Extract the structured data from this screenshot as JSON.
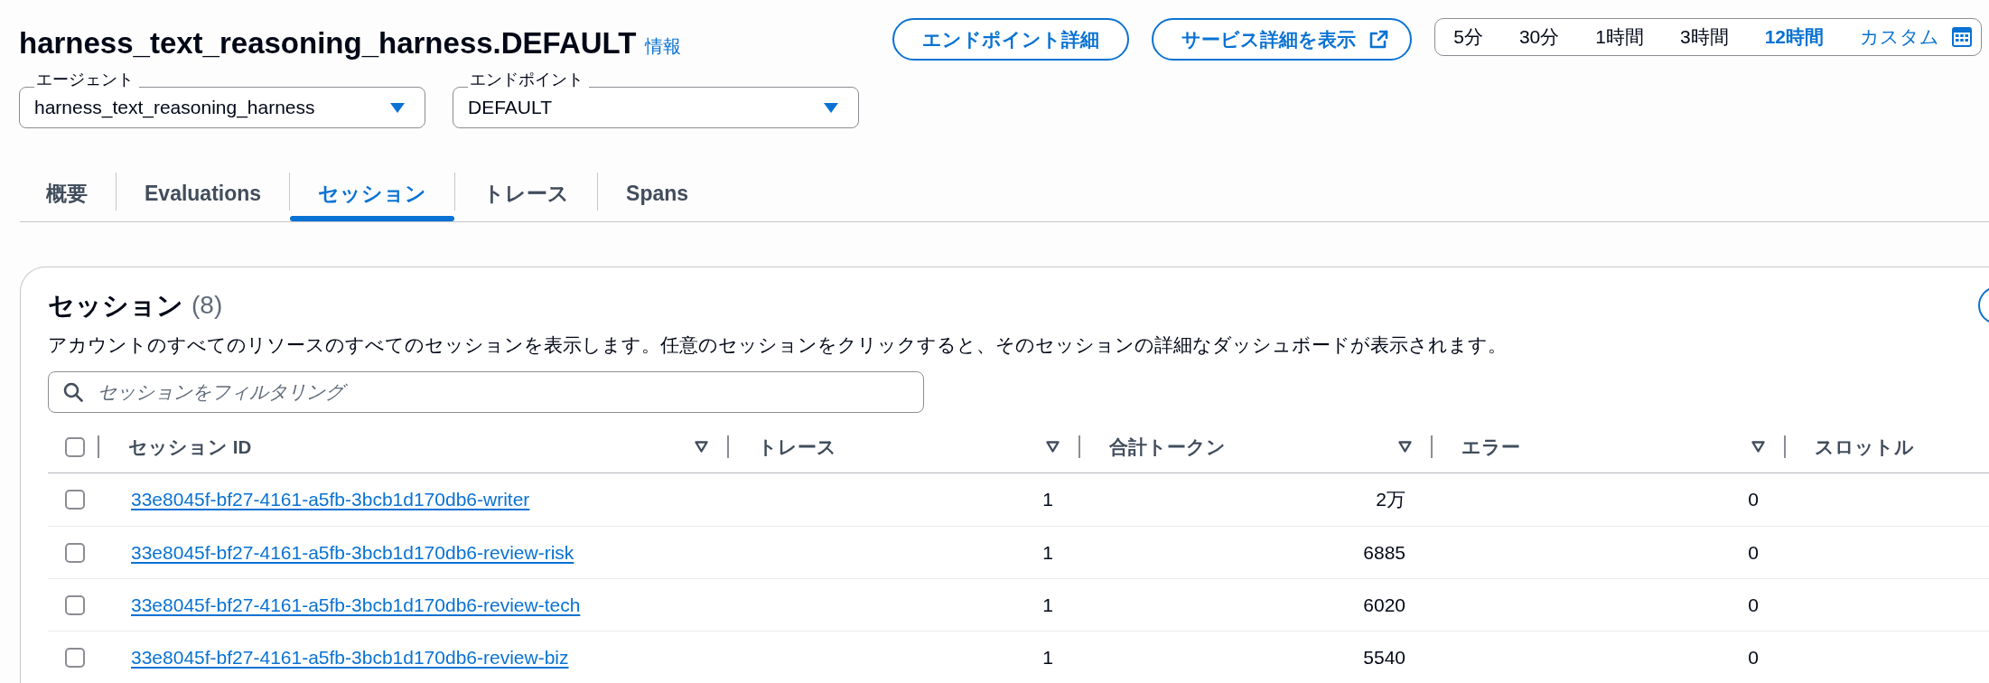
{
  "header": {
    "title": "harness_text_reasoning_harness.DEFAULT",
    "info_link": "情報"
  },
  "actions": [
    {
      "label": "エンドポイント詳細",
      "external": false
    },
    {
      "label": "サービス詳細を表示",
      "external": true
    }
  ],
  "time_range": [
    {
      "label": "5分",
      "kind": "preset",
      "selected": false
    },
    {
      "label": "30分",
      "kind": "preset",
      "selected": false
    },
    {
      "label": "1時間",
      "kind": "preset",
      "selected": false
    },
    {
      "label": "3時間",
      "kind": "preset",
      "selected": false
    },
    {
      "label": "12時間",
      "kind": "preset",
      "selected": true
    },
    {
      "label": "カスタム",
      "kind": "custom",
      "selected": false
    }
  ],
  "selectors": [
    {
      "label": "エージェント",
      "value": "harness_text_reasoning_harness"
    },
    {
      "label": "エンドポイント",
      "value": "DEFAULT"
    }
  ],
  "tabs": [
    {
      "label": "概要",
      "selected": false
    },
    {
      "label": "Evaluations",
      "selected": false
    },
    {
      "label": "セッション",
      "selected": true
    },
    {
      "label": "トレース",
      "selected": false
    },
    {
      "label": "Spans",
      "selected": false
    }
  ],
  "sessions": {
    "title": "セッション",
    "count": "(8)",
    "description": "アカウントのすべてのリソースのすべてのセッションを表示します。任意のセッションをクリックすると、そのセッションの詳細なダッシュボードが表示されます。",
    "filter": {
      "placeholder": "セッションをフィルタリング"
    },
    "table": {
      "select_all": {
        "checked": false
      },
      "columns": [
        {
          "label": "セッション ID",
          "sortable": true
        },
        {
          "label": "トレース",
          "sortable": true
        },
        {
          "label": "合計トークン",
          "sortable": true
        },
        {
          "label": "エラー",
          "sortable": true
        },
        {
          "label": "スロットル",
          "sortable": false
        }
      ],
      "rows": [
        {
          "selected": false,
          "session_id": "33e8045f-bf27-4161-a5fb-3bcb1d170db6-writer",
          "traces": "1",
          "total_tokens": "2万",
          "errors": "0"
        },
        {
          "selected": false,
          "session_id": "33e8045f-bf27-4161-a5fb-3bcb1d170db6-review-risk",
          "traces": "1",
          "total_tokens": "6885",
          "errors": "0"
        },
        {
          "selected": false,
          "session_id": "33e8045f-bf27-4161-a5fb-3bcb1d170db6-review-tech",
          "traces": "1",
          "total_tokens": "6020",
          "errors": "0"
        },
        {
          "selected": false,
          "session_id": "33e8045f-bf27-4161-a5fb-3bcb1d170db6-review-biz",
          "traces": "1",
          "total_tokens": "5540",
          "errors": "0"
        }
      ]
    }
  }
}
